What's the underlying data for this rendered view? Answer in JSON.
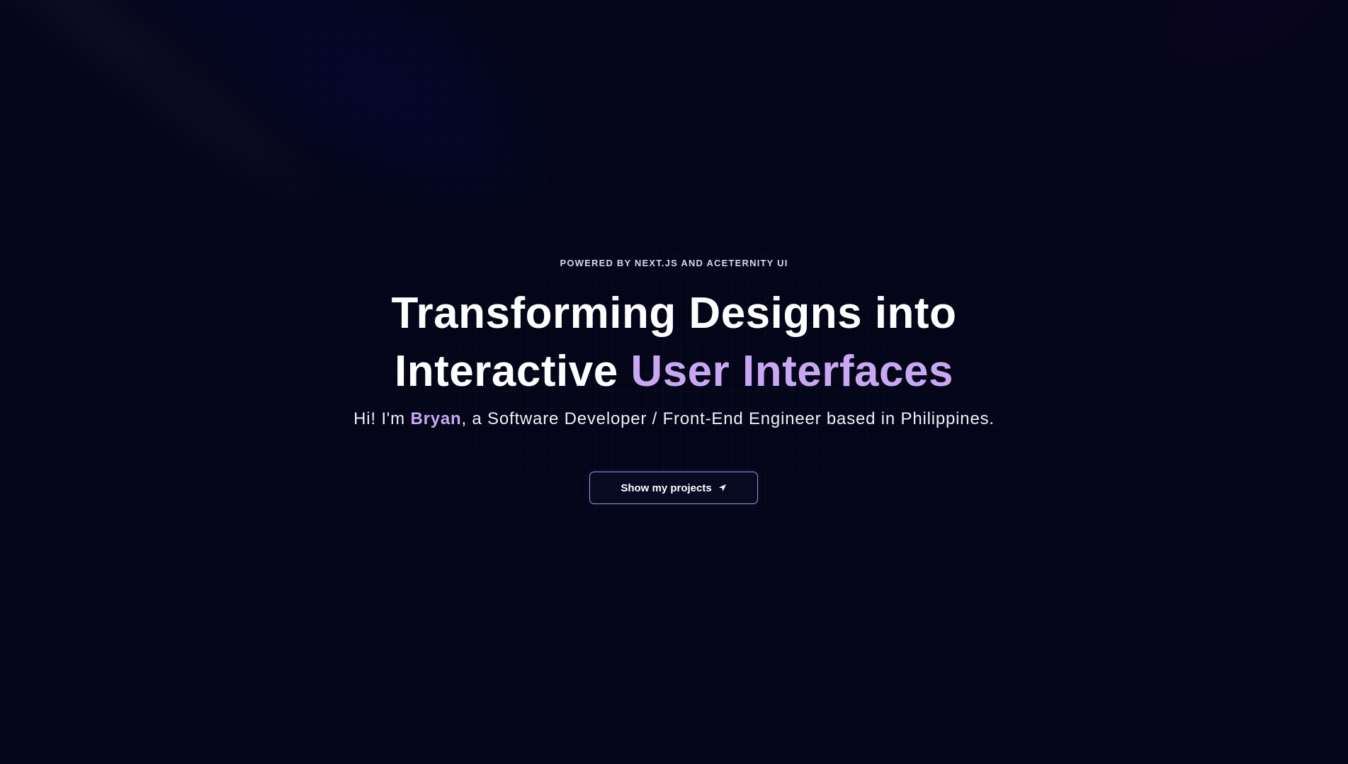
{
  "hero": {
    "eyebrow": "POWERED BY NEXT.JS AND ACETERNITY UI",
    "headline_line1": "Transforming Designs into",
    "headline_line2_plain": "Interactive ",
    "headline_line2_accent": "User Interfaces",
    "intro_prefix": "Hi! I'm ",
    "intro_name": "Bryan",
    "intro_suffix": ", a Software Developer / Front-End Engineer based in Philippines.",
    "cta_label": "Show my projects",
    "cta_icon": "send-icon"
  },
  "colors": {
    "background": "#040519",
    "accent": "#c8a8f2",
    "text": "#ffffff",
    "button_border": "#9497c8"
  }
}
